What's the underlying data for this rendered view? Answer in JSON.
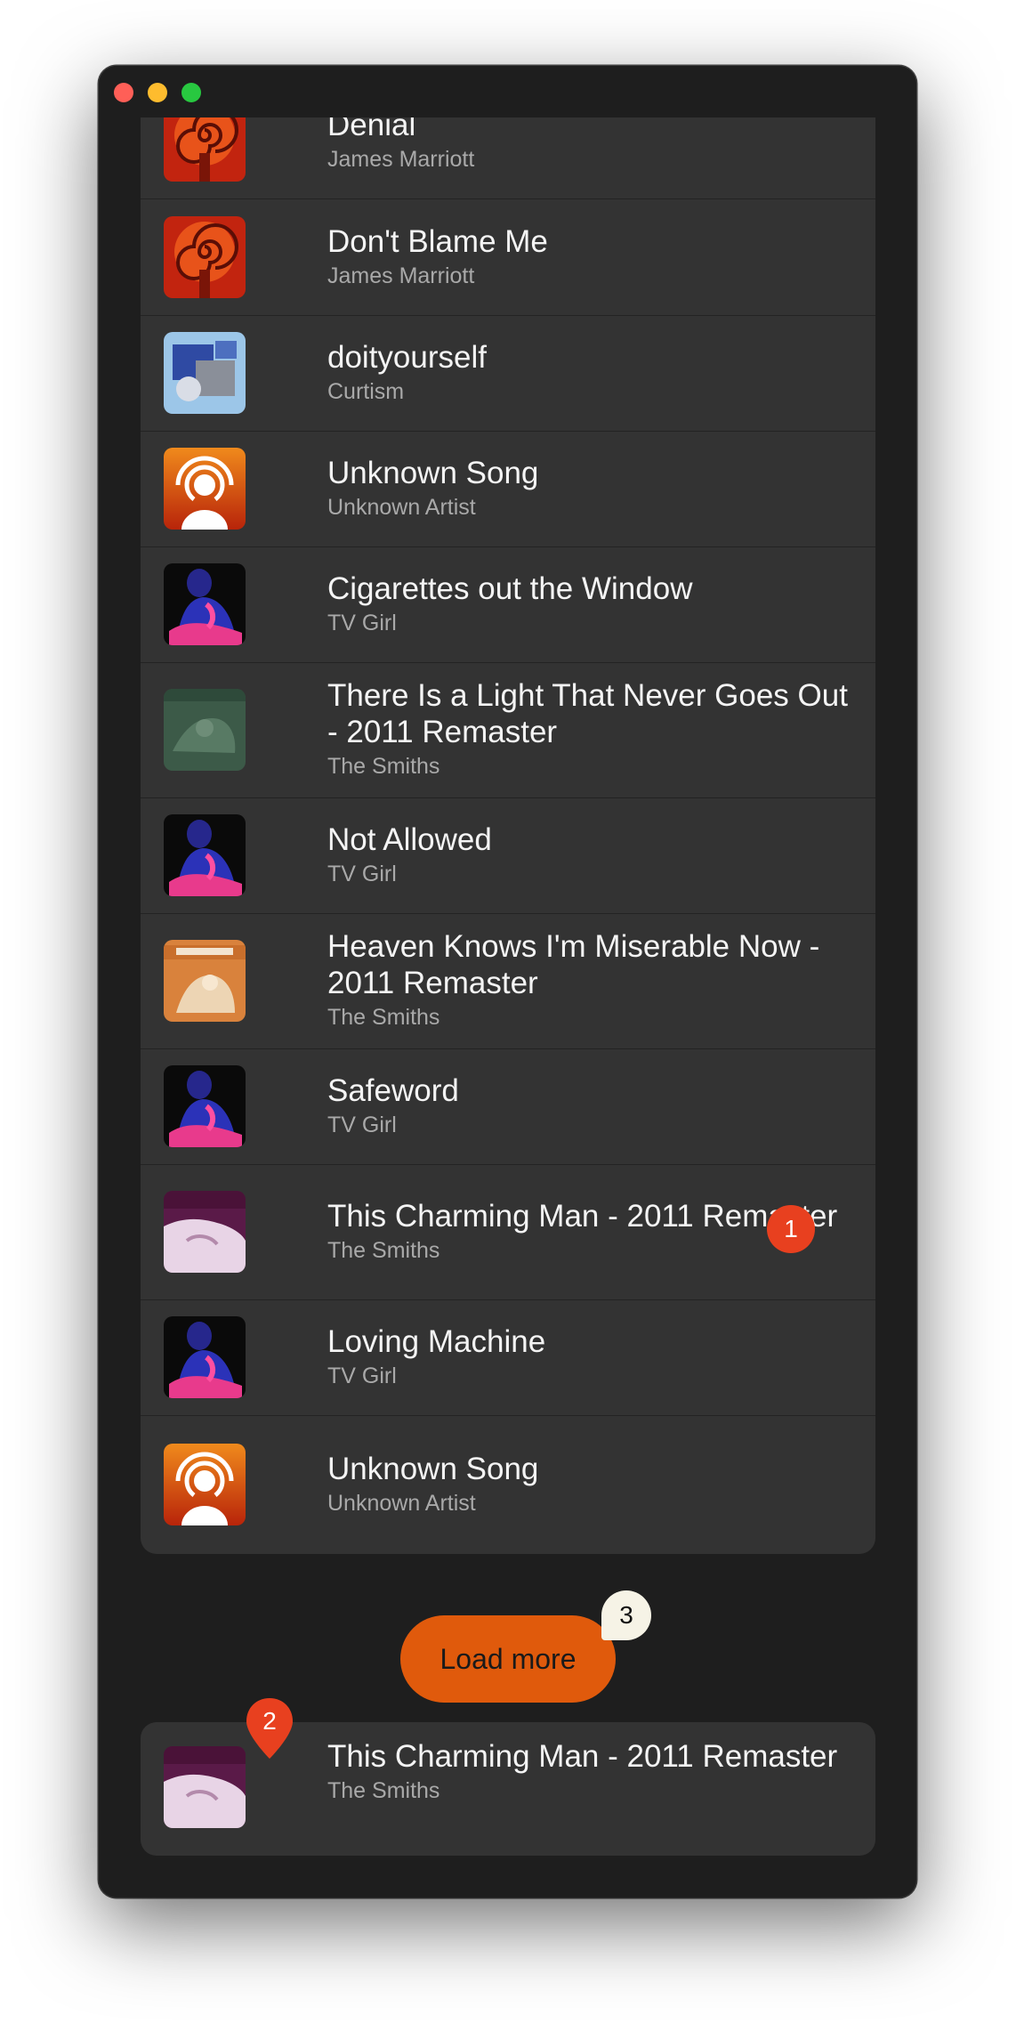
{
  "window": {
    "controls": [
      "close",
      "minimize",
      "maximize"
    ]
  },
  "songs": [
    {
      "title": "Denial",
      "artist": "James Marriott",
      "art": "spiral-art"
    },
    {
      "title": "Don't Blame Me",
      "artist": "James Marriott",
      "art": "spiral-art"
    },
    {
      "title": "doityourself",
      "artist": "Curtism",
      "art": "collage-art"
    },
    {
      "title": "Unknown Song",
      "artist": "Unknown Artist",
      "art": "podcast-icon"
    },
    {
      "title": "Cigarettes out the Window",
      "artist": "TV Girl",
      "art": "tvgirl-art"
    },
    {
      "title": "There Is a Light That Never Goes Out - 2011 Remaster",
      "artist": "The Smiths",
      "art": "queen-is-dead-art"
    },
    {
      "title": "Not Allowed",
      "artist": "TV Girl",
      "art": "tvgirl-art"
    },
    {
      "title": "Heaven Knows I'm Miserable Now - 2011 Remaster",
      "artist": "The Smiths",
      "art": "hatful-art"
    },
    {
      "title": "Safeword",
      "artist": "TV Girl",
      "art": "tvgirl-art"
    },
    {
      "title": "This Charming Man - 2011 Remaster",
      "artist": "The Smiths",
      "art": "smiths-art"
    },
    {
      "title": "Loving Machine",
      "artist": "TV Girl",
      "art": "tvgirl-art"
    },
    {
      "title": "Unknown Song",
      "artist": "Unknown Artist",
      "art": "podcast-icon"
    }
  ],
  "badges": {
    "row_badge": "1",
    "pin_badge": "2",
    "bubble_badge": "3"
  },
  "load_more": {
    "label": "Load more"
  },
  "now_playing": {
    "title": "This Charming Man - 2011 Remaster",
    "artist": "The Smiths",
    "art": "smiths-art"
  },
  "colors": {
    "window_bg": "#1e1e1e",
    "card_bg": "#333333",
    "accent": "#e05a0c",
    "badge": "#e8401f"
  }
}
